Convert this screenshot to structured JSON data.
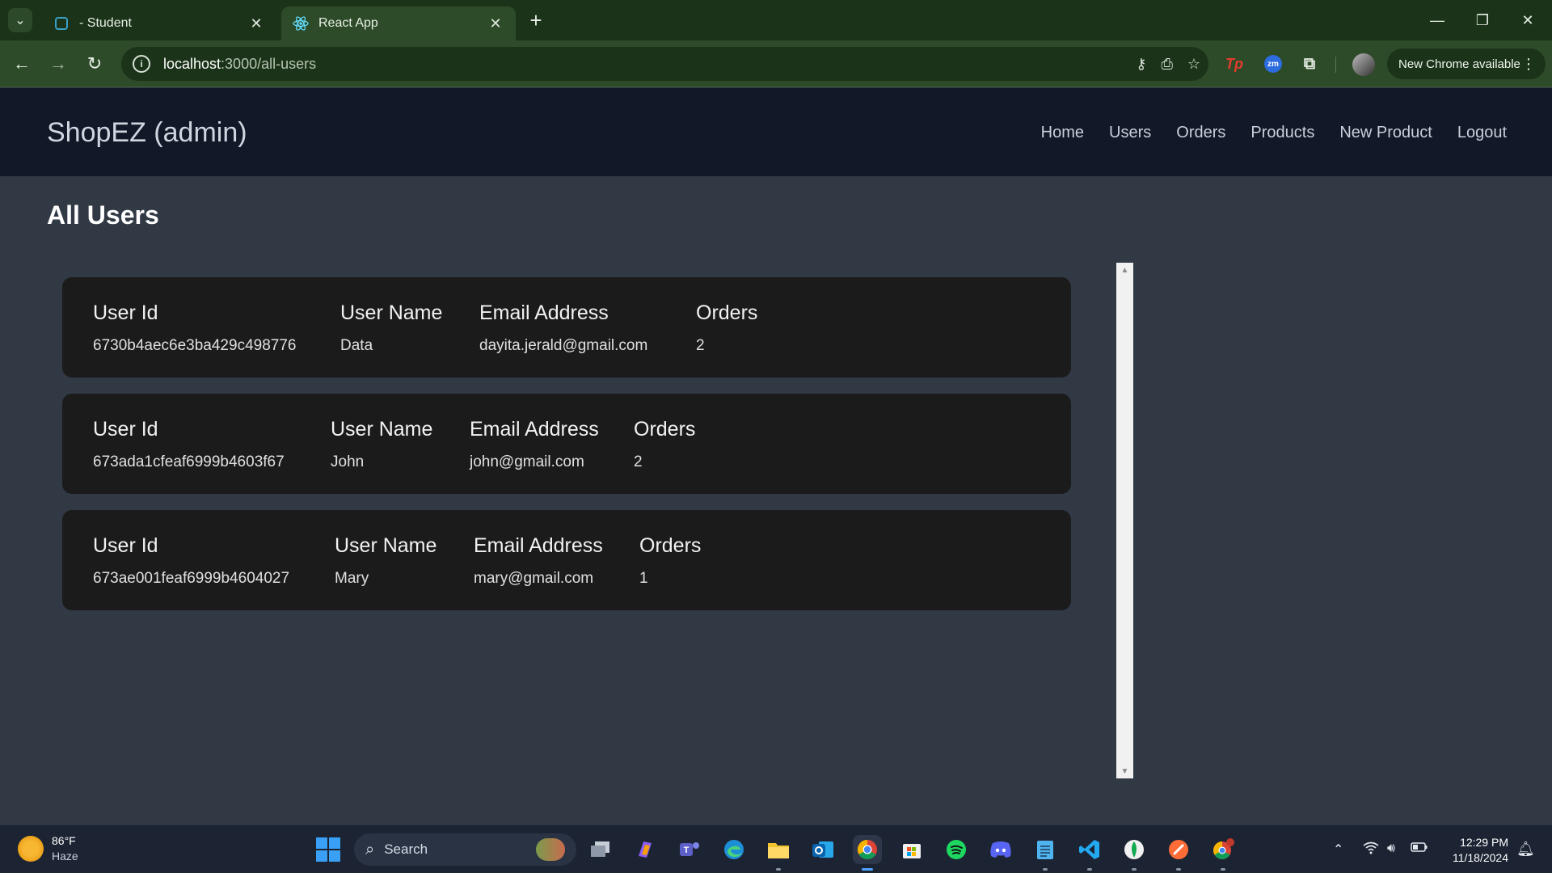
{
  "browser": {
    "tabs": [
      {
        "title": "- Student",
        "active": false
      },
      {
        "title": "React App",
        "active": true
      }
    ],
    "url_host": "localhost",
    "url_path": ":3000/all-users",
    "update_label": "New Chrome available"
  },
  "app": {
    "brand": "ShopEZ (admin)",
    "nav": [
      "Home",
      "Users",
      "Orders",
      "Products",
      "New Product",
      "Logout"
    ]
  },
  "page": {
    "title": "All Users",
    "columns": {
      "id": "User Id",
      "name": "User Name",
      "email": "Email Address",
      "orders": "Orders"
    },
    "users": [
      {
        "id": "6730b4aec6e3ba429c498776",
        "name": "Data",
        "email": "dayita.jerald@gmail.com",
        "orders": "2"
      },
      {
        "id": "673ada1cfeaf6999b4603f67",
        "name": "John",
        "email": "john@gmail.com",
        "orders": "2"
      },
      {
        "id": "673ae001feaf6999b4604027",
        "name": "Mary",
        "email": "mary@gmail.com",
        "orders": "1"
      }
    ]
  },
  "taskbar": {
    "weather_temp": "86°F",
    "weather_desc": "Haze",
    "search_label": "Search",
    "time": "12:29 PM",
    "date": "11/18/2024"
  },
  "colors": {
    "chrome_frame": "#1b3319",
    "chrome_toolbar": "#2d4b28",
    "app_navbar": "#111827",
    "page_bg": "#313945",
    "card_bg": "#1b1b1b",
    "taskbar": "#1c2433"
  }
}
